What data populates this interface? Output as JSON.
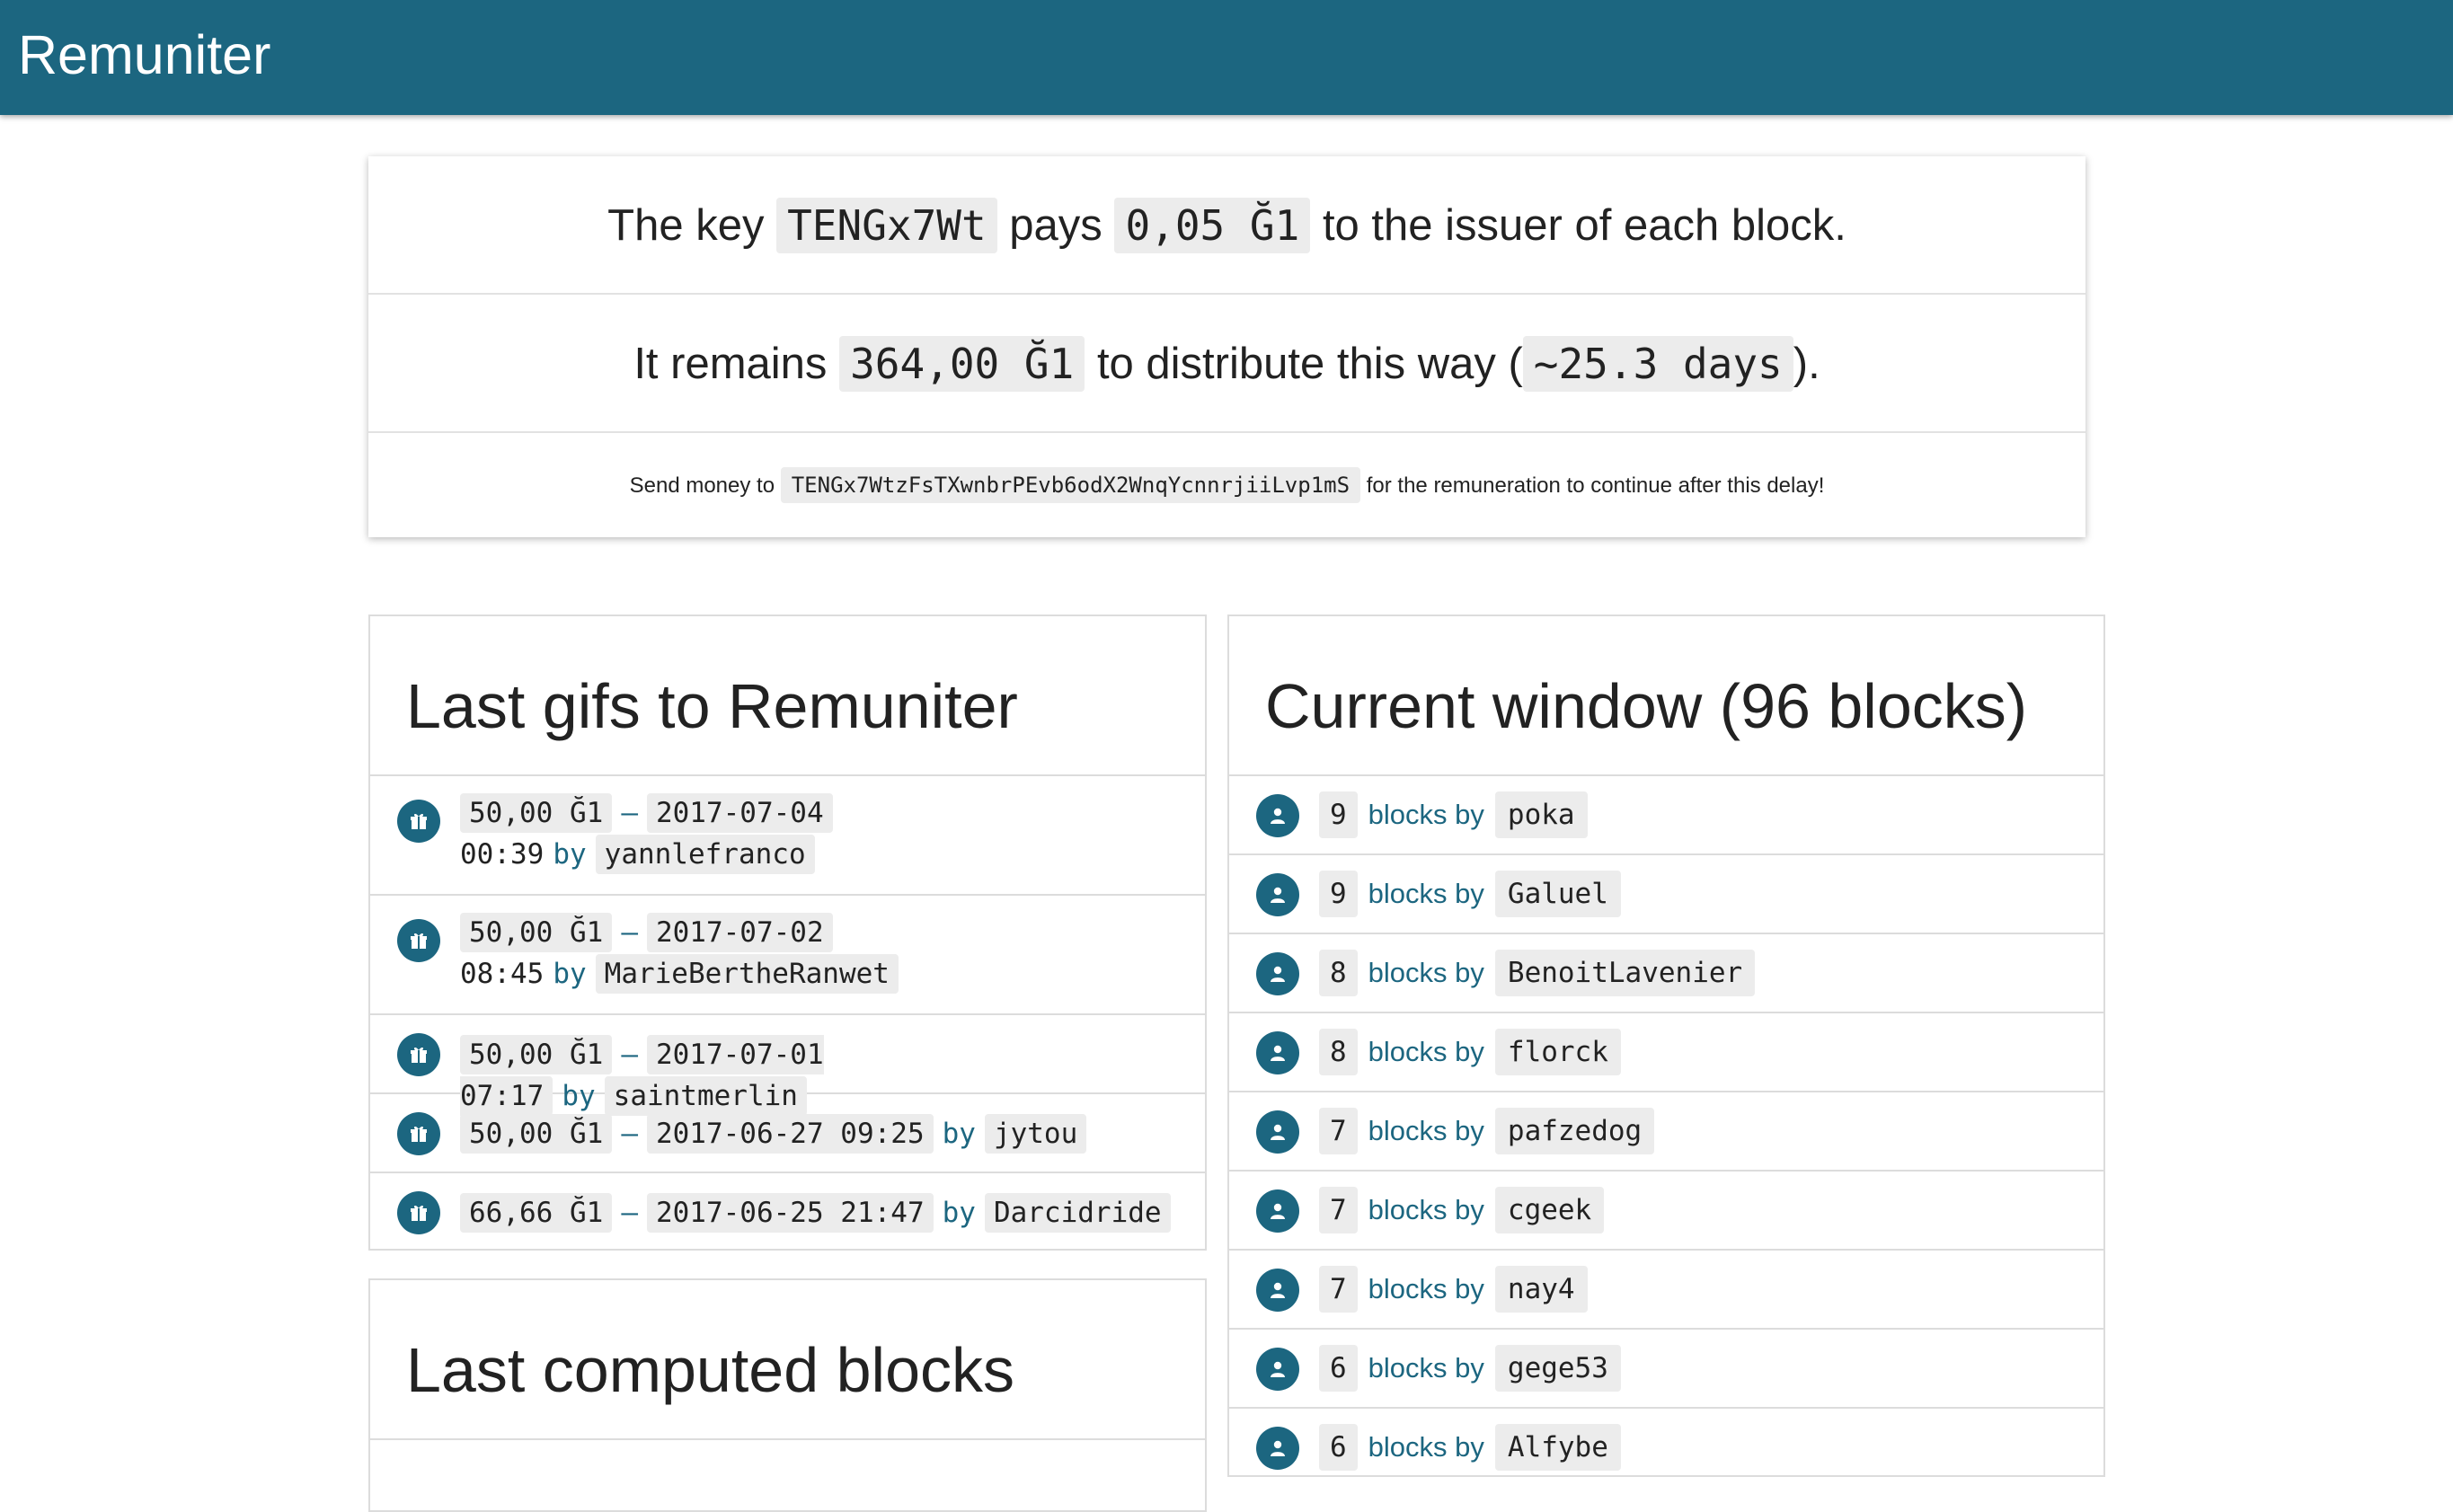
{
  "app": {
    "title": "Remuniter"
  },
  "banner": {
    "line1": {
      "prefix": "The key",
      "key": "TENGx7Wt",
      "mid": "pays",
      "amount": "0,05 Ğ1",
      "suffix": "to the issuer of each block."
    },
    "line2": {
      "prefix": "It remains",
      "amount": "364,00 Ğ1",
      "mid": "to distribute this way (",
      "days": "~25.3 days",
      "suffix": ")."
    },
    "line3": {
      "prefix": "Send money to",
      "pubkey": "TENGx7WtzFsTXwnbrPEvb6odX2WnqYcnnrjiiLvp1mS",
      "suffix": "for the remuneration to continue after this delay!"
    }
  },
  "gifts": {
    "title": "Last gifs to Remuniter",
    "sep": "–",
    "by": "by",
    "items": [
      {
        "amount": "50,00 Ğ1",
        "date": "2017-07-04",
        "time": "00:39",
        "user": "yannlefranco"
      },
      {
        "amount": "50,00 Ğ1",
        "date": "2017-07-02",
        "time": "08:45",
        "user": "MarieBertheRanwet"
      },
      {
        "amount": "50,00 Ğ1",
        "date": "2017-07-01 07:17",
        "user": "saintmerlin"
      },
      {
        "amount": "50,00 Ğ1",
        "date": "2017-06-27 09:25",
        "user": "jytou"
      },
      {
        "amount": "66,66 Ğ1",
        "date": "2017-06-25 21:47",
        "user": "Darcidride"
      }
    ]
  },
  "computed": {
    "title": "Last computed blocks"
  },
  "window": {
    "title": "Current window (96 blocks)",
    "label": "blocks by",
    "items": [
      {
        "count": "9",
        "user": "poka"
      },
      {
        "count": "9",
        "user": "Galuel"
      },
      {
        "count": "8",
        "user": "BenoitLavenier"
      },
      {
        "count": "8",
        "user": "florck"
      },
      {
        "count": "7",
        "user": "pafzedog"
      },
      {
        "count": "7",
        "user": "cgeek"
      },
      {
        "count": "7",
        "user": "nay4"
      },
      {
        "count": "6",
        "user": "gege53"
      },
      {
        "count": "6",
        "user": "Alfybe"
      }
    ]
  },
  "icons": {
    "gift": "gift-icon",
    "user": "user-icon"
  },
  "colors": {
    "brand": "#1c6680"
  }
}
